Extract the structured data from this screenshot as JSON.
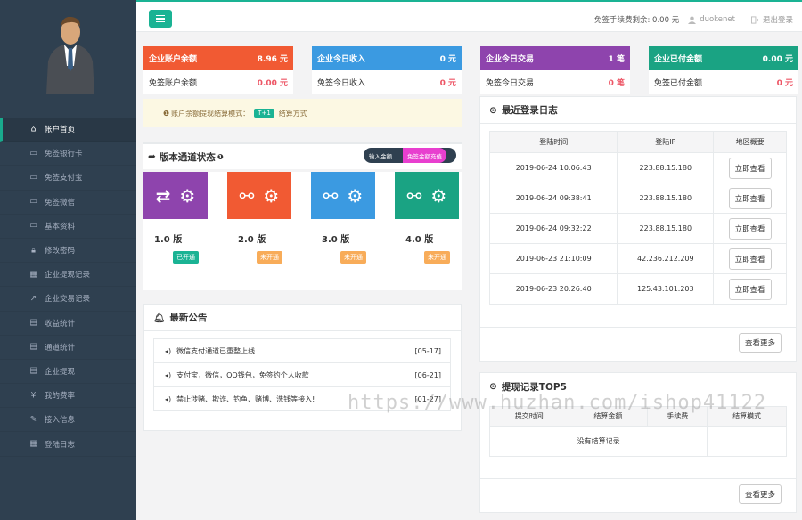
{
  "sidebar": {
    "items": [
      {
        "label": "帐户首页",
        "icon": "home-icon"
      },
      {
        "label": "免签银行卡",
        "icon": "card-icon"
      },
      {
        "label": "免签支付宝",
        "icon": "card-icon"
      },
      {
        "label": "免签微信",
        "icon": "card-icon"
      },
      {
        "label": "基本资料",
        "icon": "card-icon"
      },
      {
        "label": "修改密码",
        "icon": "lock-icon"
      },
      {
        "label": "企业提现记录",
        "icon": "calendar-icon"
      },
      {
        "label": "企业交易记录",
        "icon": "chart-icon"
      },
      {
        "label": "收益统计",
        "icon": "table-icon"
      },
      {
        "label": "通道统计",
        "icon": "table-icon"
      },
      {
        "label": "企业提现",
        "icon": "table-icon"
      },
      {
        "label": "我的费率",
        "icon": "yen-icon"
      },
      {
        "label": "接入信息",
        "icon": "wrench-icon"
      },
      {
        "label": "登陆日志",
        "icon": "calendar-icon"
      }
    ]
  },
  "header": {
    "fee_label": "免签手续费剩余: 0.00 元",
    "username": "duokenet",
    "logout": "退出登录"
  },
  "stats": [
    {
      "title": "企业账户余额",
      "value": "8.96 元",
      "sub_label": "免签账户余额",
      "sub_value": "0.00 元",
      "color": "#f15a33"
    },
    {
      "title": "企业今日收入",
      "value": "0 元",
      "sub_label": "免签今日收入",
      "sub_value": "0 元",
      "color": "#3b9ae1"
    },
    {
      "title": "企业今日交易",
      "value": "1 笔",
      "sub_label": "免签今日交易",
      "sub_value": "0 笔",
      "color": "#8e44ad"
    },
    {
      "title": "企业已付金额",
      "value": "0.00 元",
      "sub_label": "免签已付金额",
      "sub_value": "0 元",
      "color": "#1aa383"
    }
  ],
  "notice": {
    "prefix": "账户余额提现结算模式：",
    "tag": "T+1",
    "suffix": "结算方式"
  },
  "channels": {
    "title": "版本通道状态",
    "toggle_left": "输入金额",
    "toggle_right": "免签金额充值",
    "items": [
      {
        "name": "1.0 版",
        "status": "已开通",
        "color": "#8e44ad",
        "status_color": "#1ab394"
      },
      {
        "name": "2.0 版",
        "status": "未开通",
        "color": "#f15a33",
        "status_color": "#f8ac59"
      },
      {
        "name": "3.0 版",
        "status": "未开通",
        "color": "#3b9ae1",
        "status_color": "#f8ac59"
      },
      {
        "name": "4.0 版",
        "status": "未开通",
        "color": "#1aa383",
        "status_color": "#f8ac59"
      }
    ]
  },
  "announcements": {
    "title": "最新公告",
    "items": [
      {
        "text": "微信支付通道已重整上线",
        "date": "[05-17]"
      },
      {
        "text": "支付宝，微信，QQ钱包，免签约个人收款",
        "date": "[06-21]"
      },
      {
        "text": "禁止涉赌、欺诈、钓鱼、赌博、洗钱等接入!",
        "date": "[01-27]"
      }
    ]
  },
  "login_log": {
    "title": "最近登录日志",
    "headers": [
      "登陆时间",
      "登陆IP",
      "地区概要"
    ],
    "rows": [
      {
        "time": "2019-06-24 10:06:43",
        "ip": "223.88.15.180",
        "action": "立即查看"
      },
      {
        "time": "2019-06-24 09:38:41",
        "ip": "223.88.15.180",
        "action": "立即查看"
      },
      {
        "time": "2019-06-24 09:32:22",
        "ip": "223.88.15.180",
        "action": "立即查看"
      },
      {
        "time": "2019-06-23 21:10:09",
        "ip": "42.236.212.209",
        "action": "立即查看"
      },
      {
        "time": "2019-06-23 20:26:40",
        "ip": "125.43.101.203",
        "action": "立即查看"
      }
    ],
    "more": "查看更多"
  },
  "withdraw": {
    "title": "提现记录TOP5",
    "headers": [
      "提交时间",
      "结算金额",
      "手续费",
      "结算模式"
    ],
    "empty": "没有结算记录",
    "more": "查看更多"
  },
  "watermark": "https://www.huzhan.com/ishop41122"
}
